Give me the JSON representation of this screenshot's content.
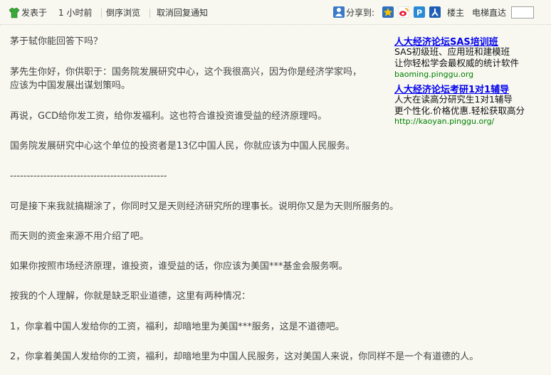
{
  "toolbar": {
    "posted": "发表于",
    "time_ago": "1 小时前",
    "reverse_browse": "倒序浏览",
    "cancel_notify": "取消回复通知",
    "share_to": "分享到:",
    "floor_owner": "楼主",
    "elevator": "电梯直达",
    "elevator_value": ""
  },
  "share_icons": [
    {
      "name": "qzone-icon",
      "color": "#f5c400"
    },
    {
      "name": "weibo-icon",
      "color": "#e6162d"
    },
    {
      "name": "pengyou-icon",
      "color": "#2a8ad6"
    },
    {
      "name": "renren-icon",
      "color": "#1e5fb5"
    }
  ],
  "post": {
    "lines": [
      "茅于轼你能回答下吗？",
      "茅先生你好，你供职于：国务院发展研究中心，这个我很高兴，因为你是经济学家吗，",
      "应该为中国发展出谋划策吗。",
      "再说，GCD给你发工资，给你发福利。这也符合谁投资谁受益的经济原理吗。",
      "国务院发展研究中心这个单位的投资者是13亿中国人民，你就应该为中国人民服务。",
      "-----------------------------------------------",
      "可是接下来我就搞糊涂了，你同时又是天则经济研究所的理事长。说明你又是为天则所服务的。",
      "而天则的资金来源不用介绍了吧。",
      "如果你按照市场经济原理，谁投资，谁受益的话，你应该为美国***基金会服务啊。",
      "按我的个人理解，你就是缺乏职业道德，这里有两种情况：",
      "1，你拿着中国人发给你的工资，福利，却暗地里为美国***服务，这是不道德吧。",
      "2，你拿着美国人发给你的工资，福利，却暗地里为中国人民服务，这对美国人来说，你同样不是一个有道德的人。"
    ]
  },
  "ads": [
    {
      "title": "人大经济论坛SAS培训班",
      "lines": [
        "SAS初级班、应用班和建模班",
        "让你轻松学会最权威的统计软件"
      ],
      "url": "baoming.pinggu.org"
    },
    {
      "title": "人大经济论坛考研1对1辅导",
      "lines": [
        "人大在读高分研究生1对1辅导",
        "更个性化.价格优惠.轻松获取高分"
      ],
      "url": "http://kaoyan.pinggu.org/"
    }
  ]
}
